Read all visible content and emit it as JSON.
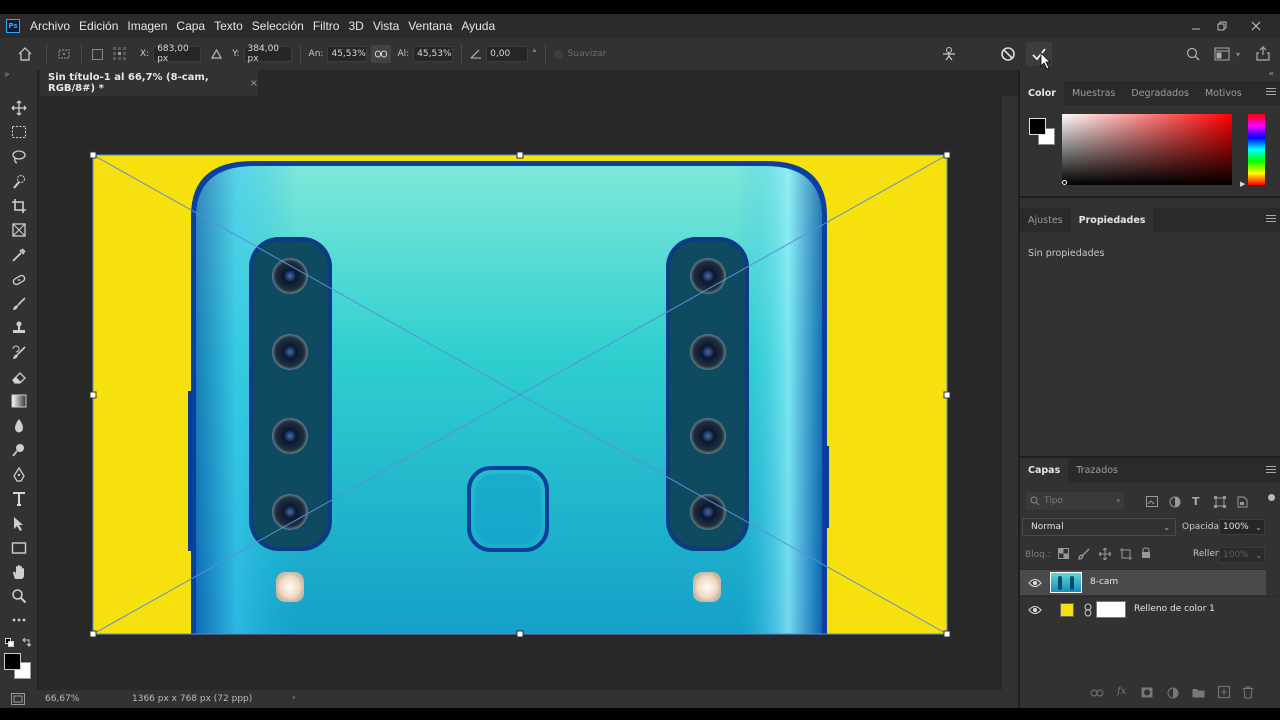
{
  "app": {
    "logo": "Ps"
  },
  "menu": [
    "Archivo",
    "Edición",
    "Imagen",
    "Capa",
    "Texto",
    "Selección",
    "Filtro",
    "3D",
    "Vista",
    "Ventana",
    "Ayuda"
  ],
  "options": {
    "x_label": "X:",
    "x_value": "683,00 px",
    "y_label": "Y:",
    "y_value": "384,00 px",
    "w_label": "An:",
    "w_value": "45,53%",
    "h_label": "Al:",
    "h_value": "45,53%",
    "angle_value": "0,00",
    "angle_unit": "°",
    "smooth_label": "Suavizar"
  },
  "document": {
    "tab_title": "Sin título-1 al 66,7% (8-cam, RGB/8#) *",
    "tab_close": "×",
    "zoom": "66,67%",
    "dimensions": "1366 px x 768 px (72 ppp)"
  },
  "color_panel": {
    "tabs": [
      "Color",
      "Muestras",
      "Degradados",
      "Motivos"
    ],
    "foreground": "#000000",
    "background": "#ffffff",
    "hue": "#ff0000"
  },
  "props_panel": {
    "tabs": [
      "Ajustes",
      "Propiedades"
    ],
    "text": "Sin propiedades"
  },
  "layers_panel": {
    "tabs": [
      "Capas",
      "Trazados"
    ],
    "filter_placeholder": "Tipo",
    "blend_mode": "Normal",
    "opacity_label": "Opacidad:",
    "opacity_value": "100%",
    "lock_label": "Bloq.:",
    "fill_label": "Relleno:",
    "fill_value": "100%",
    "layers": [
      {
        "name": "8-cam"
      },
      {
        "name": "Relleno de color 1",
        "color": "#f6e10c"
      }
    ]
  }
}
